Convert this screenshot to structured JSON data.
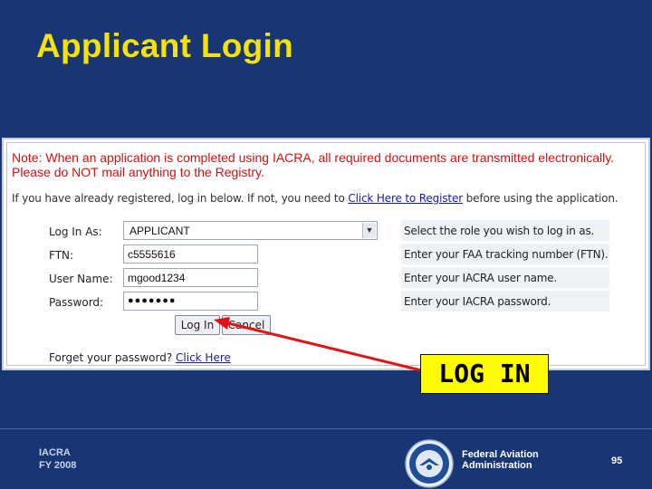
{
  "slide": {
    "title": "Applicant Login",
    "callout": "LOG IN",
    "footer_left_line1": "IACRA",
    "footer_left_line2": "FY 2008",
    "footer_org_line1": "Federal Aviation",
    "footer_org_line2": "Administration",
    "page_number": "95"
  },
  "login_page": {
    "note_line1": "Note: When an application is completed using IACRA, all required documents are transmitted electronically.",
    "note_line2": "Please do NOT mail anything to the Registry.",
    "register_prefix": "If you have already registered, log in below. If not, you need to ",
    "register_link": "Click Here to Register",
    "register_suffix": " before using the application.",
    "fields": {
      "login_as": {
        "label": "Log In As:",
        "value": "APPLICANT",
        "help": "Select the role you wish to log in as."
      },
      "ftn": {
        "label": "FTN:",
        "value": "c5555616",
        "help": "Enter your FAA tracking number (FTN)."
      },
      "username": {
        "label": "User Name:",
        "value": "mgood1234",
        "help": "Enter your IACRA user name."
      },
      "password": {
        "label": "Password:",
        "value": "●●●●●●●",
        "help": "Enter your IACRA password."
      }
    },
    "login_button": "Log In",
    "cancel_button": "Cancel",
    "forgot_prefix": "Forget your password? ",
    "forgot_link": "Click Here"
  },
  "colors": {
    "background": "#173673",
    "title": "#f5e20a",
    "note": "#d01111",
    "callout_bg": "#fffc00",
    "arrow": "#e01414"
  },
  "icons": {
    "select_arrow": "chevron-down-icon",
    "seal": "faa-seal-icon"
  }
}
